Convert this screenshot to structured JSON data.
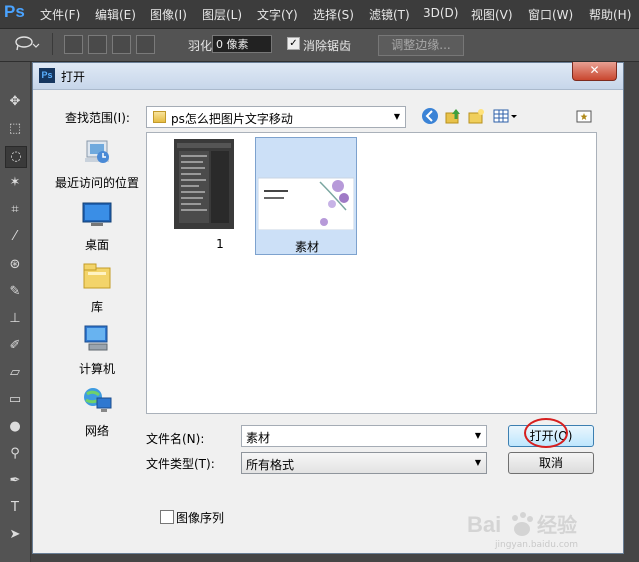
{
  "app": {
    "logo": "Ps"
  },
  "menubar": {
    "items": [
      "文件(F)",
      "编辑(E)",
      "图像(I)",
      "图层(L)",
      "文字(Y)",
      "选择(S)",
      "滤镜(T)",
      "3D(D)",
      "视图(V)",
      "窗口(W)",
      "帮助(H)"
    ]
  },
  "options": {
    "feather_label": "羽化:",
    "feather_value": "0 像素",
    "antialias_checked": true,
    "antialias_label": "消除锯齿",
    "refine_edge_label": "调整边缘..."
  },
  "dialog": {
    "title": "打开",
    "close": "✕",
    "lookin_label": "查找范围(I):",
    "lookin_value": "ps怎么把图片文字移动",
    "places": [
      "最近访问的位置",
      "桌面",
      "库",
      "计算机",
      "网络"
    ],
    "files": [
      {
        "name": "1",
        "selected": false
      },
      {
        "name": "素材",
        "selected": true
      }
    ],
    "filename_label": "文件名(N):",
    "filename_value": "素材",
    "filetype_label": "文件类型(T):",
    "filetype_value": "所有格式",
    "open_button": "打开(O)",
    "cancel_button": "取消",
    "sequence_label": "图像序列",
    "sequence_checked": false
  },
  "watermark": {
    "brand": "Bai经验",
    "url": "jingyan.baidu.com"
  },
  "colors": {
    "accent": "#4aa3ff",
    "highlight_ring": "#d61f1f",
    "selection": "#cce0f7"
  }
}
